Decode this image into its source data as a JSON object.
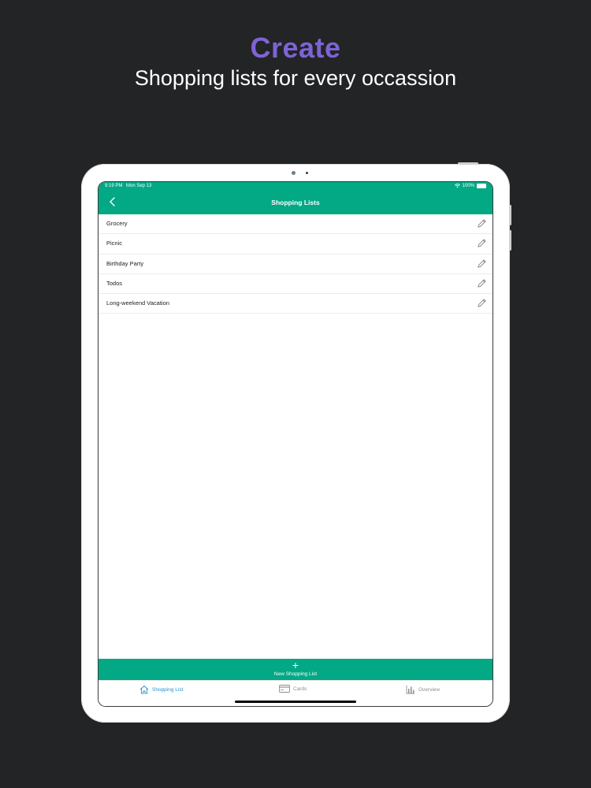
{
  "promo": {
    "headline": "Create",
    "subheadline": "Shopping lists for every occassion"
  },
  "colors": {
    "background": "#222425",
    "accent_purple": "#7e63d6",
    "brand_green": "#03a885",
    "tab_active": "#2a8fd1",
    "tab_inactive": "#8e8e93"
  },
  "statusbar": {
    "time": "9:19 PM",
    "date": "Mon Sep 13",
    "battery": "100%"
  },
  "navbar": {
    "title": "Shopping Lists",
    "back_icon": "chevron-left-icon"
  },
  "lists": [
    {
      "name": "Grocery"
    },
    {
      "name": "Picnic"
    },
    {
      "name": "Birthday Party"
    },
    {
      "name": "Todos"
    },
    {
      "name": "Long-weekend Vacation"
    }
  ],
  "new_list_button": {
    "icon": "plus-icon",
    "label": "New Shopping List"
  },
  "tabbar": {
    "tabs": [
      {
        "label": "Shopping List",
        "icon": "house-icon",
        "active": true
      },
      {
        "label": "Cards",
        "icon": "card-icon",
        "active": false
      },
      {
        "label": "Overview",
        "icon": "bar-chart-icon",
        "active": false
      }
    ]
  }
}
